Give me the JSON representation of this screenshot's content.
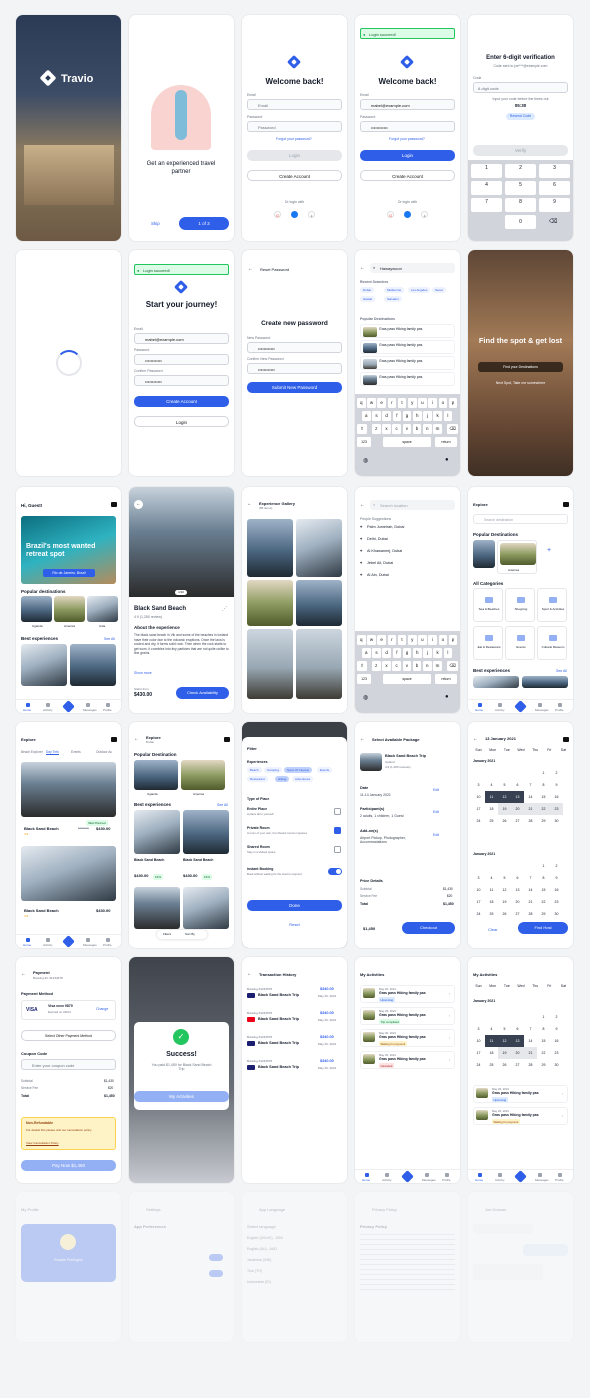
{
  "splash": {
    "brand": "Travio"
  },
  "onboard": {
    "text": "Get an experienced travel partner",
    "skip": "Skip",
    "page": "1 of 3"
  },
  "login": {
    "title": "Welcome back!",
    "email_label": "Email",
    "email_ph": "Email",
    "email_val": "mabel@example.com",
    "pw_label": "Password",
    "pw_ph": "Password",
    "pw_val": "••••••••••••",
    "forgot": "Forgot your password?",
    "login_btn": "Login",
    "create_btn": "Create Account",
    "or": "Or login with"
  },
  "login_success": {
    "toast": "Login succeed!"
  },
  "verify": {
    "title": "Enter 6-digit verification",
    "sub": "Code sent to joe***@example.com",
    "code_label": "Code",
    "code_ph": "6-digit code",
    "resend_text": "Input your code before the times out",
    "timer": "05:30",
    "resend": "Resend Code",
    "verify_btn": "Verify",
    "keys": [
      "1",
      "2",
      "3",
      "4",
      "5",
      "6",
      "7",
      "8",
      "9",
      "0"
    ],
    "letters": [
      "",
      "ABC",
      "DEF",
      "GHI",
      "JKL",
      "MNO",
      "PQRS",
      "TUV",
      "WXYZ"
    ]
  },
  "signup": {
    "toast": "Login succeed!",
    "title": "Start your journey!",
    "email_label": "Email",
    "email_val": "mabel@example.com",
    "pw_label": "Password",
    "pw_val": "••••••••••••",
    "confirm_label": "Confirm Password",
    "confirm_val": "••••••••••••",
    "create_btn": "Create Account",
    "login_btn": "Login"
  },
  "reset": {
    "header": "Reset Password",
    "title": "Create new password",
    "new_label": "New Password",
    "new_val": "••••••••••••",
    "confirm_label": "Confirm New Password",
    "confirm_val": "••••••••••••",
    "submit": "Submit New Password"
  },
  "search": {
    "query": "Hawaywoon",
    "recent_label": "Recent Searches",
    "recent": [
      "Dubai",
      "Melbourne",
      "Los Angeles",
      "Seoul",
      "Hawaii",
      "Salvador"
    ],
    "popular_label": "Popular Destinations",
    "popular": [
      "Gras pass Hiking family pas",
      "Gras pass Hiking family pas",
      "Gras pass Hiking family pas",
      "Gras pass Hiking family pas"
    ],
    "keys_row1": [
      "q",
      "w",
      "e",
      "r",
      "t",
      "y",
      "u",
      "i",
      "o",
      "p"
    ],
    "keys_row2": [
      "a",
      "s",
      "d",
      "f",
      "g",
      "h",
      "j",
      "k",
      "l"
    ],
    "keys_row3": [
      "z",
      "x",
      "c",
      "v",
      "b",
      "n",
      "m"
    ],
    "space": "space",
    "return": "return",
    "num": "123"
  },
  "hero": {
    "title": "Find the spot & get lost",
    "btn": "Find your Destinations",
    "sub": "Next Spot, Take me somewhere"
  },
  "home": {
    "greeting": "Hi, Guest!",
    "banner": "Brazil's most wanted retreat spot",
    "location": "Rio de Janeiro, Brazil",
    "popular": "Popular destinations",
    "dest": [
      "Uganda",
      "America",
      "Anta"
    ],
    "best": "Best experiences",
    "see_all": "See All",
    "nav": [
      "Home",
      "Activity",
      "",
      "Messages",
      "Profile"
    ]
  },
  "detail": {
    "title": "Black Sand Beach",
    "rating": "4.9 (1,280 review)",
    "about": "About the experience",
    "desc": "The black sand beach in Vik and some of the beaches in Iceland have their color due to the volcanic eruptions. Once the lava is cooled and dry, it forms solid rock. Then when the rock starts to get worn, it crumbles into tiny particles that are not quite unlike to fine grains.",
    "more": "Show more",
    "price_label": "Starts from",
    "price": "$430.00",
    "btn": "Check Availability",
    "counter": "1/10"
  },
  "gallery": {
    "title": "Experience Gallery",
    "sub": "(86 items)"
  },
  "loc_search": {
    "ph": "Search location",
    "label": "People Suggestions",
    "items": [
      "Palm Jumeirah, Dubai",
      "Delhi, Dubai",
      "Al Khawaneej, Dubai",
      "Jebel Ali, Dubai",
      "Al Ain, Dubai"
    ],
    "space": "space",
    "return": "return",
    "num": "123"
  },
  "explore1": {
    "title": "Explore",
    "search": "Search destination",
    "popular": "Popular Destinations",
    "card": "Anterica",
    "all": "All Categories",
    "cats": [
      "Sea & Beaches",
      "Shopping",
      "Sport & Activities",
      "Eat & Restaurant",
      "Events",
      "Cultural Museum"
    ],
    "best": "Best experiences",
    "see_all": "See All",
    "nav": [
      "Home",
      "Activity",
      "",
      "Messages",
      "Profile"
    ]
  },
  "explore2": {
    "title": "Explore",
    "tabs": [
      "Beach Explorer",
      "Day Trek",
      "Events",
      "Outdoor Ac"
    ],
    "items": [
      {
        "badge": "SEA Planned",
        "name": "Black Sand Beach",
        "old": "$430.00",
        "price": "$430.00",
        "rate": "4.9"
      },
      {
        "name": "Black Sand Beach",
        "price": "$430.00",
        "rate": "4.9"
      }
    ],
    "nav": [
      "Home",
      "Activity",
      "",
      "Messages",
      "Profile"
    ]
  },
  "explore3": {
    "title": "Explore",
    "sub": "Dubai",
    "popular": "Popular Destination",
    "dest": [
      "Uganda",
      "America"
    ],
    "best": "Best experiences",
    "see_all": "See All",
    "items": [
      {
        "name": "Black Sand Beach",
        "price": "$430.00",
        "tag": "16%"
      },
      {
        "name": "Black Sand Beach",
        "price": "$430.00",
        "tag": "16%"
      }
    ],
    "filters": "Filters",
    "sort": "Sort By"
  },
  "filter": {
    "title": "Filter",
    "exp_label": "Experiences",
    "exp": [
      "Beach",
      "Camping",
      "Sport Of Interest",
      "Events",
      "Restaurant",
      "Hiking",
      "Adventures"
    ],
    "place_label": "Type of Place",
    "places": [
      {
        "name": "Entire Place",
        "sub": "A place all to yourself"
      },
      {
        "name": "Private Room",
        "sub": "A room of your own, but shared common spaces"
      },
      {
        "name": "Shared Room",
        "sub": "Stay in a shared space"
      }
    ],
    "instant": "Instant Booking",
    "instant_sub": "Book without waiting for the Host to respond",
    "done": "Done",
    "reset": "Reset"
  },
  "package": {
    "header": "Select Available Package",
    "name": "Black Sand Beach Trip",
    "loc": "Iceland",
    "rate": "4.9 (1,280 reviews)",
    "date_label": "Date",
    "date": "11-14 January 2021",
    "part_label": "Participant(s)",
    "part": "2 adults, 1 children, 1 Guest",
    "addon_label": "Add-on(s)",
    "addon": "Airport Pickup, Photographer, Accommodations",
    "edit": "Edit",
    "price_label": "Price Details",
    "subtotal": "Subtotal",
    "subtotal_val": "$1,430",
    "fee": "Service Fee",
    "fee_val": "$20",
    "total": "Total",
    "total_val": "$1,450",
    "bottom_total": "$1,450",
    "checkout": "Checkout"
  },
  "calendar": {
    "title": "13 January 2021",
    "days": [
      "Sun",
      "Mon",
      "Tue",
      "Wed",
      "Thu",
      "Fri",
      "Sat"
    ],
    "month1": "January 2021",
    "month2": "January 2021",
    "clear": "Clear",
    "find": "Find Host"
  },
  "payment": {
    "title": "Payment",
    "sub": "Booking ID: #1234678",
    "method": "Payment Method",
    "card_name": "Visa xxxx 9879",
    "card_exp": "Expired on 06/24",
    "change": "Change",
    "other": "Select Other Payment Method",
    "coupon": "Coupon Code",
    "coupon_ph": "Enter your coupon code",
    "subtotal": "Subtotal",
    "subtotal_val": "$1,430",
    "fee": "Service Fee",
    "fee_val": "$20",
    "total": "Total",
    "total_val": "$1,450",
    "note_title": "Non-Refundable",
    "note": "For details this please visit our cancellation policy",
    "note_link": "View Cancellation Policy",
    "pay": "Pay Now $1,450"
  },
  "success": {
    "title": "Success!",
    "desc": "You paid $1,450 for Black Sand Beach Trip",
    "btn": "My Activities"
  },
  "history": {
    "title": "Transaction History",
    "items": [
      {
        "id": "Booking #1234678",
        "name": "Black Sand Beach Trip",
        "amount": "$340.00",
        "date": "May 20, 2021"
      },
      {
        "id": "Booking #1234678",
        "name": "Black Sand Beach Trip",
        "amount": "$340.00",
        "date": "May 20, 2021"
      },
      {
        "id": "Booking #1234678",
        "name": "Black Sand Beach Trip",
        "amount": "$340.00",
        "date": "May 20, 2021"
      },
      {
        "id": "Booking #1234678",
        "name": "Black Sand Beach Trip",
        "amount": "$340.00",
        "date": "May 20, 2021"
      }
    ]
  },
  "activities": {
    "title": "My Activities",
    "items": [
      {
        "date": "May 20, 2021",
        "name": "Gras pass Hiking family pas",
        "status": "Upcoming"
      },
      {
        "date": "May 20, 2021",
        "name": "Gras pass Hiking family pas",
        "status": "Trip completed"
      },
      {
        "date": "May 20, 2021",
        "name": "Gras pass Hiking family pas",
        "status": "Waiting for payment"
      },
      {
        "date": "May 20, 2021",
        "name": "Gras pass Hiking family pas",
        "status": "Canceled"
      }
    ],
    "nav": [
      "Home",
      "Activity",
      "",
      "Messages",
      "Profile"
    ]
  },
  "activities2": {
    "title": "My Activities",
    "month": "January 2021",
    "days": [
      "Sun",
      "Mon",
      "Tue",
      "Wed",
      "Thu",
      "Fri",
      "Sat"
    ],
    "items": [
      {
        "date": "May 20, 2021",
        "name": "Gras pass Hiking family pas",
        "status": "Upcoming"
      },
      {
        "date": "May 20, 2021",
        "name": "Gras pass Hiking family pas",
        "status": "Waiting for payment"
      }
    ],
    "nav": [
      "Home",
      "Activity",
      "",
      "Messages",
      "Profile"
    ]
  },
  "faded": {
    "profile": "My Profile",
    "user": "Rosalie Purrington",
    "settings": "Settings",
    "prefs": "App Preferences",
    "lang": "App Language",
    "select_lang": "Select language",
    "langs": [
      "English (US/UK) - USD",
      "English (AU) - AUD",
      "Javanese (IND)",
      "Thai (TH)",
      "Indonesian (ID)"
    ],
    "privacy": "Privacy Policy",
    "privacy_h": "Privacy Policy",
    "chat": "Joe Duncan"
  }
}
